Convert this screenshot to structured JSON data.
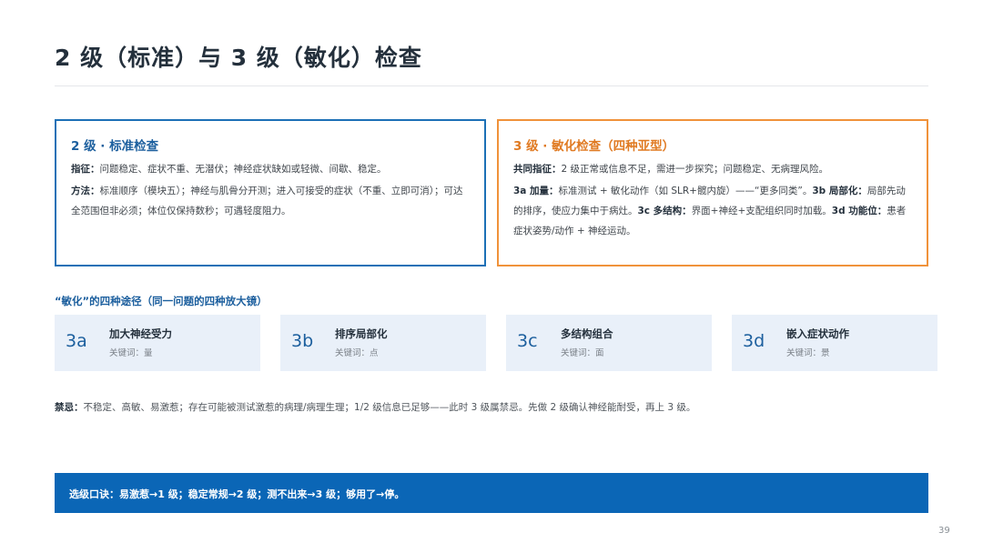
{
  "title": "2 级（标准）与 3 级（敏化）检查",
  "cards": {
    "standard": {
      "title": "2 级 · 标准检查",
      "indication_label": "指征：",
      "indication_text": "问题稳定、症状不重、无潜伏；神经症状缺如或轻微、间歇、稳定。",
      "method_label": "方法：",
      "method_text": "标准顺序（模块五）；神经与肌骨分开测；进入可接受的症状（不重、立即可消）；可达全范围但非必须；体位仅保持数秒；可遇轻度阻力。"
    },
    "sensitized": {
      "title": "3 级 · 敏化检查（四种亚型）",
      "common_label": "共同指征：",
      "common_text": "2 级正常或信息不足，需进一步探究；问题稳定、无病理风险。",
      "a_label": "3a 加量：",
      "a_text": "标准测试 + 敏化动作（如 SLR+髋内旋）——“更多同类”。",
      "b_label": "3b 局部化：",
      "b_text": "局部先动的排序，使应力集中于病灶。",
      "c_label": "3c 多结构：",
      "c_text": "界面+神经+支配组织同时加载。",
      "d_label": "3d 功能位：",
      "d_text": "患者症状姿势/动作 + 神经运动。"
    }
  },
  "section_title": "“敏化”的四种途径（同一问题的四种放大镜）",
  "lenses": [
    {
      "code": "3a",
      "name": "加大神经受力",
      "keyword": "关键词：量"
    },
    {
      "code": "3b",
      "name": "排序局部化",
      "keyword": "关键词：点"
    },
    {
      "code": "3c",
      "name": "多结构组合",
      "keyword": "关键词：面"
    },
    {
      "code": "3d",
      "name": "嵌入症状动作",
      "keyword": "关键词：景"
    }
  ],
  "ban_label": "禁忌：",
  "ban_text": "不稳定、高敏、易激惹；存在可能被测试激惹的病理/病理生理；1/2 级信息已足够——此时 3 级属禁忌。先做 2 级确认神经能耐受，再上 3 级。",
  "bottom_bar": "选级口诀：易激惹→1 级；稳定常规→2 级；测不出来→3 级；够用了→停。",
  "page_number": "39",
  "colors": {
    "accent_blue": "#1c70b6",
    "accent_orange": "#f0923a",
    "bar_blue": "#0b66b6",
    "lens_bg": "#e9f0f9"
  }
}
